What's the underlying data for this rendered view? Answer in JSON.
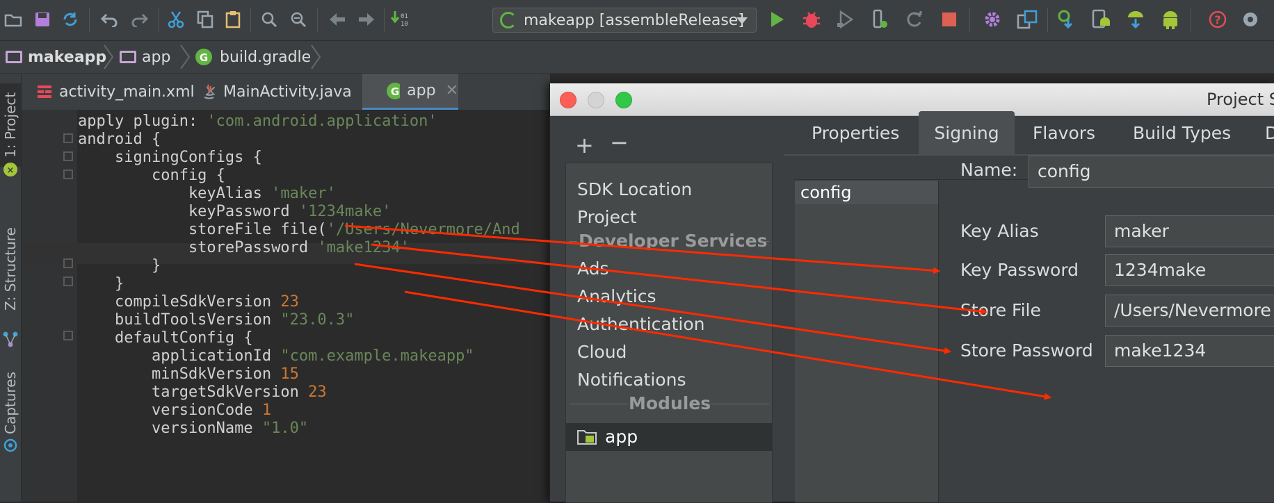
{
  "colors": {
    "accent_red_arrow": "#ff2a00",
    "run_green": "#62b543",
    "debug_red": "#e8485a",
    "stop_red": "#dd6152",
    "help_red": "#e14d55",
    "android_green": "#a4c639"
  },
  "toolbar": {
    "icons": [
      "open-folder-icon",
      "save-icon",
      "sync-icon",
      "undo-icon",
      "redo-icon",
      "cut-icon",
      "copy-icon",
      "paste-icon",
      "search-icon",
      "replace-icon",
      "back-icon",
      "forward-icon",
      "make-project-icon",
      "run-config-icon",
      "run-icon",
      "debug-icon",
      "coverage-icon",
      "profile-icon",
      "apply-changes-icon",
      "stop-icon",
      "settings-icon",
      "project-structure-icon",
      "sync-gradle-icon",
      "avd-manager-icon",
      "sdk-manager-icon",
      "android-monitor-icon",
      "help-icon",
      "capture-icon"
    ],
    "run_config_label": "makeapp [assembleRelease]"
  },
  "breadcrumb": {
    "items": [
      "makeapp",
      "app",
      "build.gradle"
    ]
  },
  "side_tabs": {
    "project": "1: Project",
    "structure": "Z: Structure",
    "captures": "Captures"
  },
  "editor_tabs": [
    {
      "label": "activity_main.xml"
    },
    {
      "label": "MainActivity.java"
    },
    {
      "label": "app"
    }
  ],
  "code": {
    "l1_a": "apply plugin: ",
    "l1_b": "'com.android.application'",
    "l3": "android {",
    "l4": "    signingConfigs {",
    "l5": "        config {",
    "l6_a": "            keyAlias ",
    "l6_b": "'maker'",
    "l7_a": "            keyPassword ",
    "l7_b": "'1234make'",
    "l8_a": "            storeFile file(",
    "l8_b": "'/Users/Nevermore/And",
    "l9_a": "            storePassword ",
    "l9_b": "'make1234'",
    "l10": "        }",
    "l11": "    }",
    "l12_a": "    compileSdkVersion ",
    "l12_b": "23",
    "l13_a": "    buildToolsVersion ",
    "l13_b": "\"23.0.3\"",
    "l14": "    defaultConfig {",
    "l15_a": "        applicationId ",
    "l15_b": "\"com.example.makeapp\"",
    "l16_a": "        minSdkVersion ",
    "l16_b": "15",
    "l17_a": "        targetSdkVersion ",
    "l17_b": "23",
    "l18_a": "        versionCode ",
    "l18_b": "1",
    "l19_a": "        versionName ",
    "l19_b": "\"1.0\""
  },
  "dialog": {
    "title": "Project S",
    "add": "+",
    "remove": "−",
    "nav": {
      "sdk_location": "SDK Location",
      "project": "Project",
      "developer_services": "Developer Services",
      "ads": "Ads",
      "analytics": "Analytics",
      "authentication": "Authentication",
      "cloud": "Cloud",
      "notifications": "Notifications",
      "modules": "Modules",
      "app": "app"
    },
    "tabs": {
      "properties": "Properties",
      "signing": "Signing",
      "flavors": "Flavors",
      "build_types": "Build Types",
      "dependencies": "D"
    },
    "config_list": [
      "config"
    ],
    "form": {
      "name_label": "Name:",
      "name_value": "config",
      "key_alias_label": "Key Alias",
      "key_alias_value": "maker",
      "key_password_label": "Key Password",
      "key_password_value": "1234make",
      "store_file_label": "Store File",
      "store_file_value": "/Users/Nevermore",
      "store_password_label": "Store Password",
      "store_password_value": "make1234"
    }
  }
}
